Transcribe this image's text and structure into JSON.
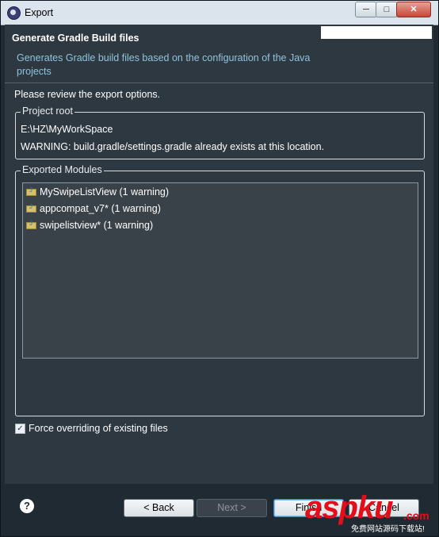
{
  "window": {
    "title": "Export",
    "buttons": {
      "minimize": "─",
      "maximize": "□",
      "close": "✕"
    }
  },
  "header": {
    "title": "Generate Gradle Build files",
    "description": "Generates Gradle build files based on the configuration of the Java projects"
  },
  "main": {
    "prompt": "Please review the export options.",
    "project_root": {
      "label": "Project root",
      "path": "E:\\HZ\\MyWorkSpace",
      "warning": "WARNING: build.gradle/settings.gradle already exists at this location."
    },
    "modules": {
      "label": "Exported Modules",
      "items": [
        {
          "label": "MySwipeListView (1 warning)"
        },
        {
          "label": "appcompat_v7* (1 warning)"
        },
        {
          "label": "swipelistview* (1 warning)"
        }
      ]
    },
    "force_override": {
      "label": "Force overriding of existing files",
      "checked": true
    }
  },
  "footer": {
    "help": "?",
    "back": "< Back",
    "next": "Next >",
    "finish": "Finish",
    "cancel": "Cancel"
  },
  "watermark": {
    "brand": "aspku",
    "tld": ".com",
    "tagline": "免费网站源码下载站!"
  }
}
